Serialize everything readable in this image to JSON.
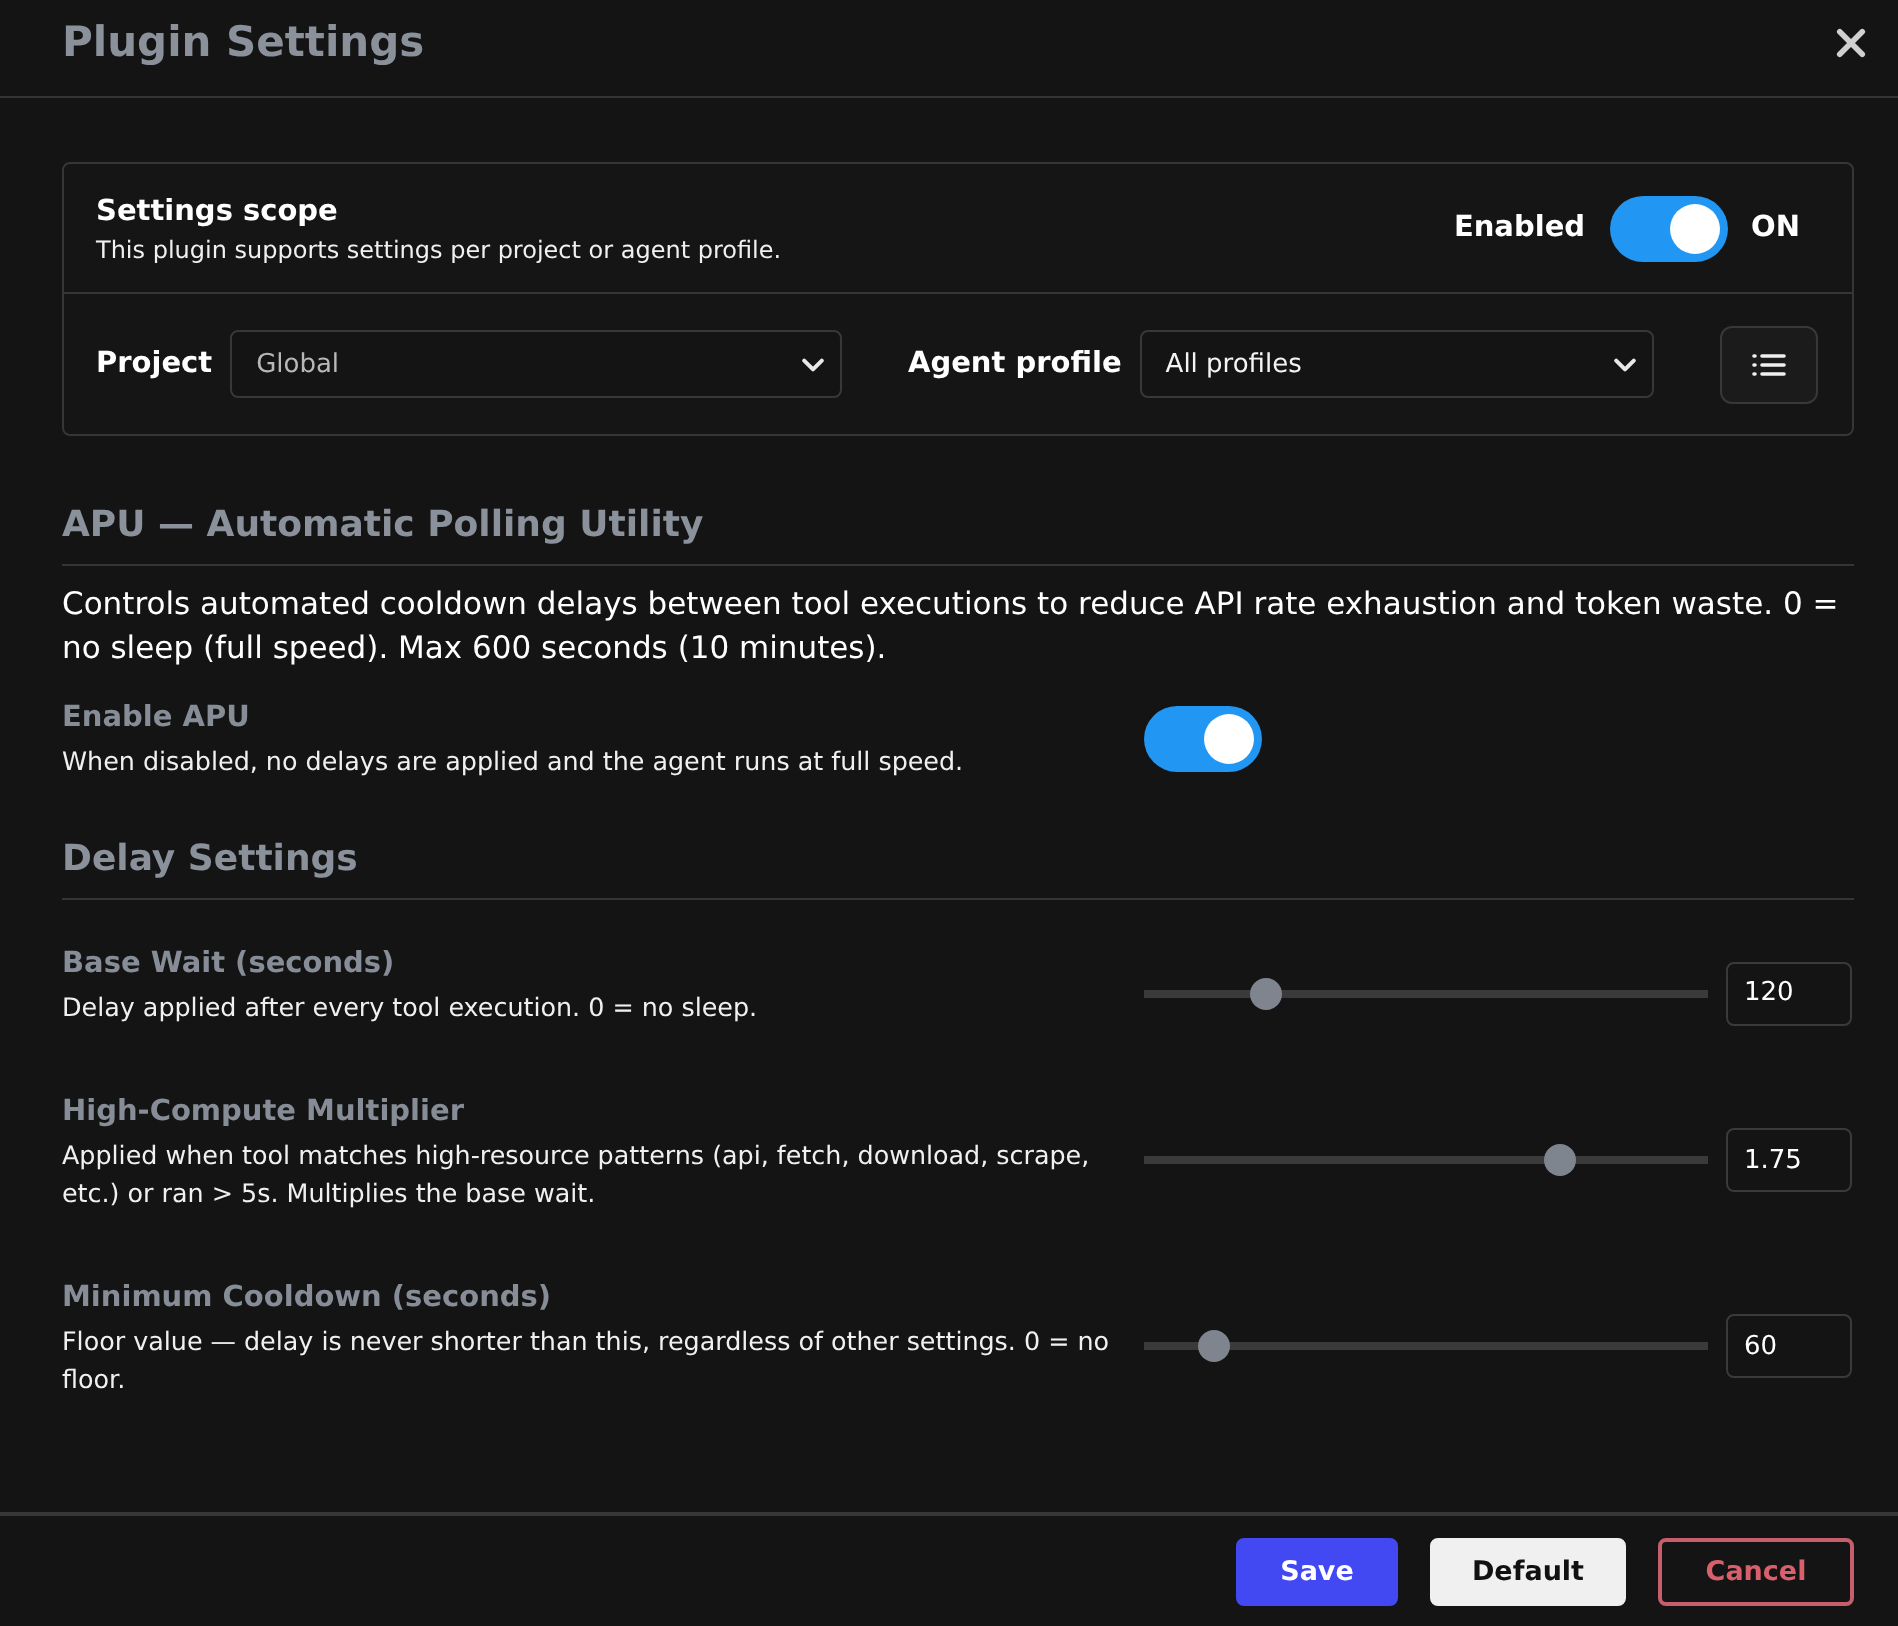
{
  "window": {
    "title": "Plugin Settings"
  },
  "scope": {
    "title": "Settings scope",
    "description": "This plugin supports settings per project or agent profile.",
    "enabled": {
      "label": "Enabled",
      "on": true,
      "state_label": "ON"
    },
    "project": {
      "label": "Project",
      "value": "Global"
    },
    "agent_profile": {
      "label": "Agent profile",
      "value": "All profiles"
    }
  },
  "apu": {
    "heading": "APU — Automatic Polling Utility",
    "description": "Controls automated cooldown delays between tool executions to reduce API rate exhaustion and token waste. 0 = no sleep (full speed). Max 600 seconds (10 minutes).",
    "enable": {
      "label": "Enable APU",
      "description": "When disabled, no delays are applied and the agent runs at full speed.",
      "on": true
    }
  },
  "delay": {
    "heading": "Delay Settings",
    "settings": [
      {
        "label": "Base Wait (seconds)",
        "description": "Delay applied after every tool execution. 0 = no sleep.",
        "level": 0.2,
        "value": "120"
      },
      {
        "label": "High-Compute Multiplier",
        "description": "Applied when tool matches high-resource patterns (api, fetch, download, scrape, etc.) or ran > 5s. Multiplies the base wait.",
        "level": 0.75,
        "value": "1.75"
      },
      {
        "label": "Minimum Cooldown (seconds)",
        "description": "Floor value — delay is never shorter than this, regardless of other settings. 0 = no floor.",
        "level": 0.1,
        "value": "60"
      }
    ]
  },
  "buttons": [
    {
      "kind": "primary",
      "label": "Save"
    },
    {
      "kind": "secondary",
      "label": "Default"
    },
    {
      "kind": "danger",
      "label": "Cancel"
    }
  ]
}
